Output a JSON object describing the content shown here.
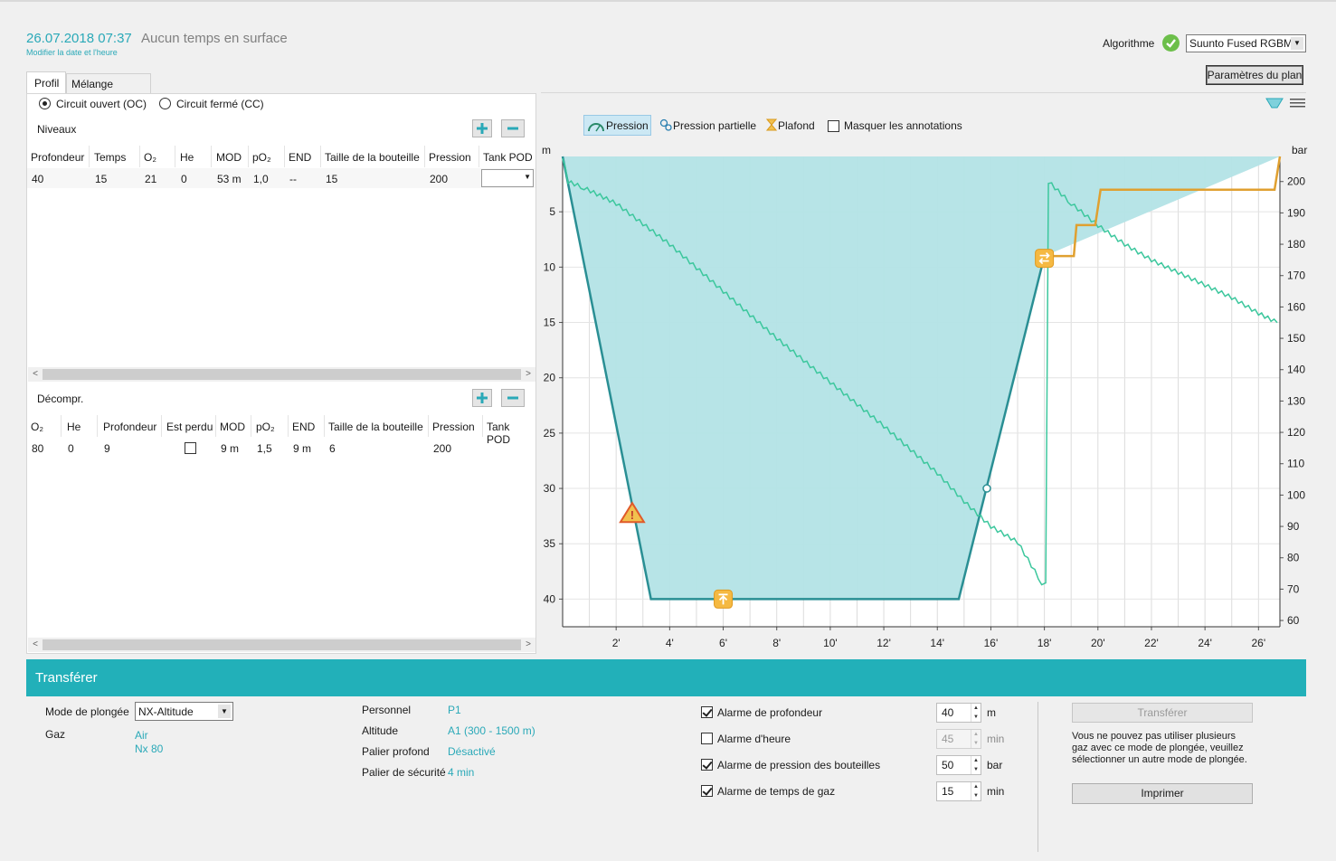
{
  "header": {
    "datetime": "26.07.2018 07:37",
    "surface": "Aucun temps en surface",
    "modify_link": "Modifier la date et l'heure",
    "algo_label": "Algorithme",
    "algo_value": "Suunto Fused RGBM",
    "plan_params": "Paramètres du plan"
  },
  "tabs": [
    "Profil",
    "Mélange gazeux"
  ],
  "circuit": {
    "open": "Circuit ouvert (OC)",
    "closed": "Circuit fermé (CC)"
  },
  "levels": {
    "title": "Niveaux",
    "columns": [
      "Profondeur",
      "Temps",
      "O₂",
      "He",
      "MOD",
      "pO₂",
      "END",
      "Taille de la bouteille",
      "Pression",
      "Tank POD"
    ],
    "row": [
      "40",
      "15",
      "21",
      "0",
      "53 m",
      "1,0",
      "--",
      "15",
      "200"
    ]
  },
  "deco": {
    "title": "Décompr.",
    "columns": [
      "O₂",
      "He",
      "Profondeur",
      "Est perdu",
      "MOD",
      "pO₂",
      "END",
      "Taille de la bouteille",
      "Pression",
      "Tank POD"
    ],
    "row": [
      "80",
      "0",
      "9",
      "",
      "9 m",
      "1,5",
      "9 m",
      "6",
      "200"
    ]
  },
  "chart_toolbar": {
    "pression": "Pression",
    "partielle": "Pression partielle",
    "plafond": "Plafond",
    "masquer": "Masquer les annotations"
  },
  "chart_data": {
    "type": "line",
    "left_unit": "m",
    "right_unit": "bar",
    "x_ticks": [
      "2'",
      "4'",
      "6'",
      "8'",
      "10'",
      "12'",
      "14'",
      "16'",
      "18'",
      "20'",
      "22'",
      "24'",
      "26'"
    ],
    "y_ticks": [
      "5",
      "10",
      "15",
      "20",
      "25",
      "30",
      "35",
      "40"
    ],
    "y2_ticks": [
      "200",
      "190",
      "180",
      "170",
      "160",
      "150",
      "140",
      "130",
      "120",
      "110",
      "100",
      "90",
      "80",
      "70",
      "60"
    ],
    "xlim": [
      0,
      26.8
    ],
    "ylim": [
      0,
      42.5
    ],
    "y2lim": [
      58,
      208
    ],
    "series": [
      {
        "x": [
          0,
          3.3,
          14.8,
          18.0,
          26.8
        ],
        "y": [
          0,
          40,
          40,
          9,
          0
        ]
      },
      {
        "x": [
          0,
          0.2,
          0.8,
          2,
          4,
          6,
          8,
          10,
          12,
          14,
          15,
          16,
          17,
          17.9,
          18.05,
          18.15,
          19,
          20,
          21,
          22,
          23,
          24,
          25,
          26,
          26.7
        ],
        "y": [
          208,
          200,
          198,
          193,
          180,
          165,
          150,
          136,
          122,
          107,
          98,
          90,
          85,
          72,
          72,
          200,
          193,
          186,
          180,
          175,
          171,
          167,
          163,
          158,
          155
        ]
      },
      {
        "x": [
          18.0,
          19.1,
          19.2,
          19.9,
          20.1,
          26.6,
          26.8
        ],
        "y": [
          9,
          9,
          6.2,
          6.2,
          3.0,
          3.0,
          0
        ]
      }
    ]
  },
  "transfer": {
    "title": "Transférer",
    "mode_label": "Mode de plongée",
    "mode_value": "NX-Altitude",
    "gas_label": "Gaz",
    "gases": [
      "Air",
      "Nx 80"
    ],
    "personal_label": "Personnel",
    "personal_value": "P1",
    "altitude_label": "Altitude",
    "altitude_value": "A1 (300 - 1500 m)",
    "deep_label": "Palier profond",
    "deep_value": "Désactivé",
    "safety_label": "Palier de sécurité",
    "safety_value": "4 min",
    "alarms": [
      {
        "label": "Alarme de profondeur",
        "checked": true,
        "value": "40",
        "unit": "m",
        "disabled": false
      },
      {
        "label": "Alarme d'heure",
        "checked": false,
        "value": "45",
        "unit": "min",
        "disabled": true
      },
      {
        "label": "Alarme de pression des bouteilles",
        "checked": true,
        "value": "50",
        "unit": "bar",
        "disabled": false
      },
      {
        "label": "Alarme de temps de gaz",
        "checked": true,
        "value": "15",
        "unit": "min",
        "disabled": false
      }
    ],
    "transfer_btn": "Transférer",
    "note": "Vous ne pouvez pas utiliser plusieurs gaz avec ce mode de plongée, veuillez sélectionner un autre mode de plongée.",
    "print_btn": "Imprimer"
  }
}
